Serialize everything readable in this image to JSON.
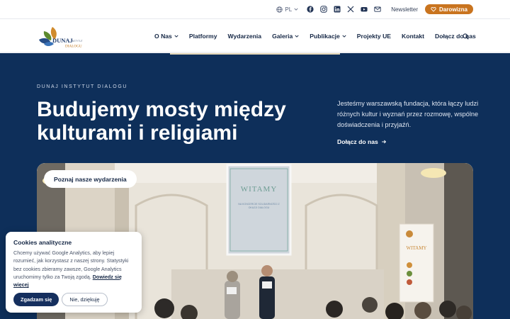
{
  "topbar": {
    "lang": "PL",
    "social_icons": [
      "facebook-icon",
      "instagram-icon",
      "linkedin-icon",
      "x-icon",
      "youtube-icon",
      "mail-icon"
    ],
    "newsletter": "Newsletter",
    "donate": "Darowizna"
  },
  "logo": {
    "line1": "DUNAJ",
    "line2": "INSTYTUT",
    "line3": "DIALOGU"
  },
  "nav": {
    "items": [
      {
        "label": "O Nas",
        "dropdown": true
      },
      {
        "label": "Platformy",
        "dropdown": false
      },
      {
        "label": "Wydarzenia",
        "dropdown": false
      },
      {
        "label": "Galeria",
        "dropdown": true
      },
      {
        "label": "Publikacje",
        "dropdown": true
      },
      {
        "label": "Projekty UE",
        "dropdown": false
      },
      {
        "label": "Kontakt",
        "dropdown": false
      },
      {
        "label": "Dołącz do nas",
        "dropdown": false
      }
    ]
  },
  "hero": {
    "eyebrow": "DUNAJ INSTYTUT DIALOGU",
    "title": "Budujemy mosty między kulturami i religiami",
    "text": "Jesteśmy warszawską fundacja, która łączy ludzi różnych kultur i wyznań przez rozmowę, wspólne doświadczenia i przyjaźń.",
    "join": "Dołącz do nas"
  },
  "event": {
    "pill": "Poznaj nasze wydarzenia",
    "slide_title": "WITAMY",
    "slide_subtitle": "NA KONCERCIE SOLIDARNOŚCI Z OKAZJI DIALOGU",
    "banner_title": "WITAMY"
  },
  "cookie": {
    "title": "Cookies analityczne",
    "text": "Chcemy używać Google Analytics, aby lepiej rozumieć, jak korzystasz z naszej strony. Statystyki bez cookies zbieramy zawsze, Google Analytics uruchomimy tylko za Twoją zgodą.",
    "link": "Dowiedz się więcej",
    "accept": "Zgadzam się",
    "decline": "Nie, dziękuję"
  },
  "colors": {
    "navy": "#0e2f5a",
    "accent": "#c9741f",
    "white": "#ffffff"
  }
}
